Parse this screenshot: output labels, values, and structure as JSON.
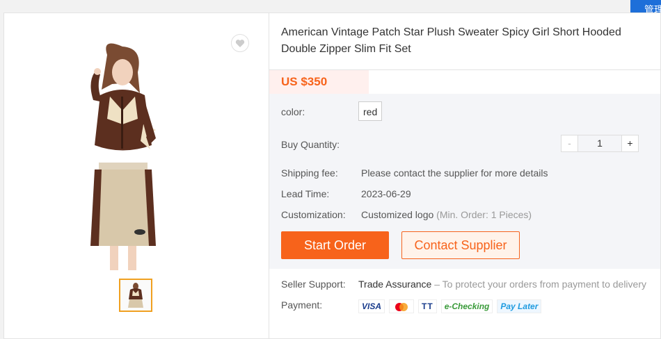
{
  "corner_button": {
    "label": "管理"
  },
  "product": {
    "title": "American Vintage Patch Star Plush Sweater Spicy Girl Short Hooded Double Zipper Slim Fit Set",
    "price": "US $350"
  },
  "specs": {
    "color_label": "color:",
    "color_value": "red",
    "quantity_label": "Buy Quantity:",
    "quantity_minus": "-",
    "quantity_value": "1",
    "quantity_plus": "+",
    "shipping_label": "Shipping fee:",
    "shipping_value": "Please contact the supplier for more details",
    "lead_label": "Lead Time:",
    "lead_value": "2023-06-29",
    "custom_label": "Customization:",
    "custom_value": "Customized logo",
    "custom_note": "(Min. Order: 1 Pieces)"
  },
  "actions": {
    "start_order": "Start Order",
    "contact_supplier": "Contact Supplier"
  },
  "support": {
    "seller_label": "Seller Support:",
    "seller_value": "Trade Assurance",
    "seller_note": "– To protect your orders from payment to delivery",
    "payment_label": "Payment:",
    "payment_methods": [
      "VISA",
      "",
      "TT",
      "e-Checking",
      "Pay Later"
    ]
  },
  "colors": {
    "accent": "#f7631b",
    "corner": "#1e6fd9",
    "spec_bg": "#f4f5f8"
  }
}
